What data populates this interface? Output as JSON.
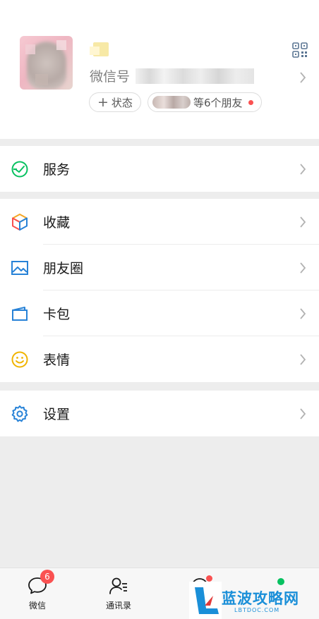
{
  "profile": {
    "wechat_id_label": "微信号",
    "status_label": "状态",
    "friends_label": "等6个朋友",
    "icons": {
      "qr": "qr-code-icon",
      "chevron": "chevron-right-icon",
      "plus": "plus-icon"
    }
  },
  "menu": {
    "service": {
      "label": "服务",
      "icon": "wallet-check-icon",
      "color": "#07c160"
    },
    "favorites": {
      "label": "收藏",
      "icon": "cube-icon"
    },
    "moments": {
      "label": "朋友圈",
      "icon": "image-icon",
      "color": "#2782d7"
    },
    "cards": {
      "label": "卡包",
      "icon": "card-icon",
      "color": "#2782d7"
    },
    "stickers": {
      "label": "表情",
      "icon": "smiley-icon",
      "color": "#f0b400"
    },
    "settings": {
      "label": "设置",
      "icon": "gear-icon",
      "color": "#2782d7"
    }
  },
  "tabbar": {
    "chats": {
      "label": "微信",
      "badge": "6"
    },
    "contacts": {
      "label": "通讯录"
    }
  },
  "watermark": {
    "title": "蓝波攻略网",
    "sub": "LBTDOC.COM"
  },
  "colors": {
    "accent": "#07c160",
    "badge": "#fa5151",
    "watermark": "#1a8fd8"
  }
}
